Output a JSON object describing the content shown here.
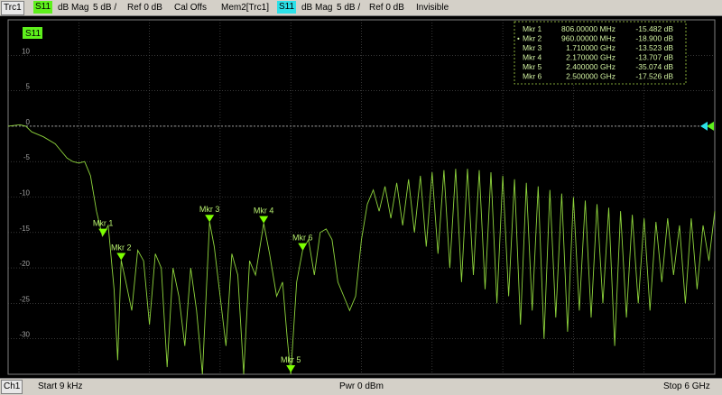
{
  "header": {
    "trc_label": "Trc1",
    "trc_param": "S11",
    "trc_format": "dB Mag",
    "trc_scale": "5 dB /",
    "trc_ref": "Ref 0 dB",
    "cal": "Cal Offs",
    "mem_label": "Mem2[Trc1]",
    "mem_param": "S11",
    "mem_format": "dB Mag",
    "mem_scale": "5 dB /",
    "mem_ref": "Ref 0 dB",
    "mem_state": "Invisible"
  },
  "plot": {
    "trace_tag": "S11",
    "y_ticks": [
      "10",
      "5",
      "0",
      "-5",
      "-10",
      "-15",
      "-20",
      "-25",
      "-30"
    ],
    "colors": {
      "trace": "#8ed43c",
      "grid": "#5a5a5a",
      "marker": "#7cff00",
      "ref": "#2ce0e8"
    }
  },
  "markers": [
    {
      "name": "Mkr 1",
      "freq": "806.00000 MHz",
      "value": "-15.482 dB",
      "active": false
    },
    {
      "name": "Mkr 2",
      "freq": "960.00000 MHz",
      "value": "-18.900 dB",
      "active": true
    },
    {
      "name": "Mkr 3",
      "freq": "1.710000 GHz",
      "value": "-13.523 dB",
      "active": false
    },
    {
      "name": "Mkr 4",
      "freq": "2.170000 GHz",
      "value": "-13.707 dB",
      "active": false
    },
    {
      "name": "Mkr 5",
      "freq": "2.400000 GHz",
      "value": "-35.074 dB",
      "active": false
    },
    {
      "name": "Mkr 6",
      "freq": "2.500000 GHz",
      "value": "-17.526 dB",
      "active": false
    }
  ],
  "chart_data": {
    "type": "line",
    "x_unit": "GHz",
    "xlim": [
      9e-06,
      6
    ],
    "ylim": [
      -35,
      15
    ],
    "grid": true,
    "series": [
      {
        "name": "S11",
        "points": [
          [
            0.0,
            0.0
          ],
          [
            0.1,
            0.2
          ],
          [
            0.15,
            0.0
          ],
          [
            0.2,
            -0.8
          ],
          [
            0.3,
            -1.5
          ],
          [
            0.4,
            -2.5
          ],
          [
            0.45,
            -3.5
          ],
          [
            0.5,
            -4.5
          ],
          [
            0.55,
            -5.0
          ],
          [
            0.6,
            -5.2
          ],
          [
            0.65,
            -5.0
          ],
          [
            0.7,
            -7
          ],
          [
            0.75,
            -12
          ],
          [
            0.8,
            -15.5
          ],
          [
            0.85,
            -14
          ],
          [
            0.9,
            -23
          ],
          [
            0.93,
            -33
          ],
          [
            0.96,
            -18.9
          ],
          [
            1.0,
            -22
          ],
          [
            1.05,
            -26
          ],
          [
            1.1,
            -17.5
          ],
          [
            1.15,
            -19
          ],
          [
            1.2,
            -28
          ],
          [
            1.25,
            -18
          ],
          [
            1.3,
            -20
          ],
          [
            1.35,
            -34
          ],
          [
            1.4,
            -20
          ],
          [
            1.45,
            -24
          ],
          [
            1.5,
            -31
          ],
          [
            1.55,
            -20
          ],
          [
            1.6,
            -26
          ],
          [
            1.65,
            -37
          ],
          [
            1.71,
            -13.5
          ],
          [
            1.75,
            -17
          ],
          [
            1.8,
            -24
          ],
          [
            1.85,
            -31
          ],
          [
            1.9,
            -18
          ],
          [
            1.95,
            -21
          ],
          [
            2.0,
            -37
          ],
          [
            2.05,
            -19
          ],
          [
            2.1,
            -21
          ],
          [
            2.17,
            -13.7
          ],
          [
            2.22,
            -18
          ],
          [
            2.28,
            -24
          ],
          [
            2.33,
            -22
          ],
          [
            2.37,
            -30
          ],
          [
            2.4,
            -35.1
          ],
          [
            2.45,
            -22
          ],
          [
            2.5,
            -17.5
          ],
          [
            2.55,
            -16
          ],
          [
            2.6,
            -21
          ],
          [
            2.65,
            -15
          ],
          [
            2.7,
            -14.5
          ],
          [
            2.75,
            -16
          ],
          [
            2.8,
            -22
          ],
          [
            2.85,
            -24
          ],
          [
            2.9,
            -26
          ],
          [
            2.95,
            -24
          ],
          [
            3.0,
            -16
          ],
          [
            3.05,
            -11
          ],
          [
            3.1,
            -9
          ],
          [
            3.15,
            -12
          ],
          [
            3.2,
            -8.5
          ],
          [
            3.25,
            -13
          ],
          [
            3.3,
            -8
          ],
          [
            3.35,
            -14
          ],
          [
            3.4,
            -7.5
          ],
          [
            3.45,
            -15
          ],
          [
            3.5,
            -7
          ],
          [
            3.55,
            -17
          ],
          [
            3.6,
            -6.5
          ],
          [
            3.65,
            -18
          ],
          [
            3.7,
            -6.2
          ],
          [
            3.75,
            -20
          ],
          [
            3.8,
            -6
          ],
          [
            3.85,
            -22
          ],
          [
            3.9,
            -6
          ],
          [
            3.95,
            -21
          ],
          [
            4.0,
            -6.2
          ],
          [
            4.05,
            -23
          ],
          [
            4.1,
            -6.5
          ],
          [
            4.15,
            -25
          ],
          [
            4.2,
            -7
          ],
          [
            4.25,
            -24
          ],
          [
            4.3,
            -7.5
          ],
          [
            4.35,
            -28
          ],
          [
            4.4,
            -8
          ],
          [
            4.45,
            -26
          ],
          [
            4.5,
            -8.5
          ],
          [
            4.55,
            -30
          ],
          [
            4.6,
            -9
          ],
          [
            4.65,
            -27
          ],
          [
            4.7,
            -9.5
          ],
          [
            4.75,
            -29
          ],
          [
            4.8,
            -10
          ],
          [
            4.85,
            -26
          ],
          [
            4.9,
            -10.5
          ],
          [
            4.95,
            -27
          ],
          [
            5.0,
            -11
          ],
          [
            5.05,
            -25
          ],
          [
            5.1,
            -11.5
          ],
          [
            5.15,
            -31
          ],
          [
            5.2,
            -12
          ],
          [
            5.25,
            -27
          ],
          [
            5.3,
            -12.5
          ],
          [
            5.35,
            -25
          ],
          [
            5.4,
            -13
          ],
          [
            5.45,
            -26
          ],
          [
            5.5,
            -13.5
          ],
          [
            5.55,
            -22
          ],
          [
            5.6,
            -13
          ],
          [
            5.65,
            -21
          ],
          [
            5.7,
            -14
          ],
          [
            5.75,
            -25
          ],
          [
            5.8,
            -13
          ],
          [
            5.85,
            -23
          ],
          [
            5.9,
            -14
          ],
          [
            5.95,
            -19
          ],
          [
            6.0,
            -12
          ]
        ]
      }
    ],
    "markers": [
      {
        "name": "Mkr 1",
        "x": 0.806,
        "y": -15.482
      },
      {
        "name": "Mkr 2",
        "x": 0.96,
        "y": -18.9
      },
      {
        "name": "Mkr 3",
        "x": 1.71,
        "y": -13.523
      },
      {
        "name": "Mkr 4",
        "x": 2.17,
        "y": -13.707
      },
      {
        "name": "Mkr 5",
        "x": 2.4,
        "y": -35.074
      },
      {
        "name": "Mkr 6",
        "x": 2.5,
        "y": -17.526
      }
    ]
  },
  "footer": {
    "channel": "Ch1",
    "start": "Start  9 kHz",
    "power": "Pwr  0 dBm",
    "stop": "Stop  6 GHz"
  }
}
